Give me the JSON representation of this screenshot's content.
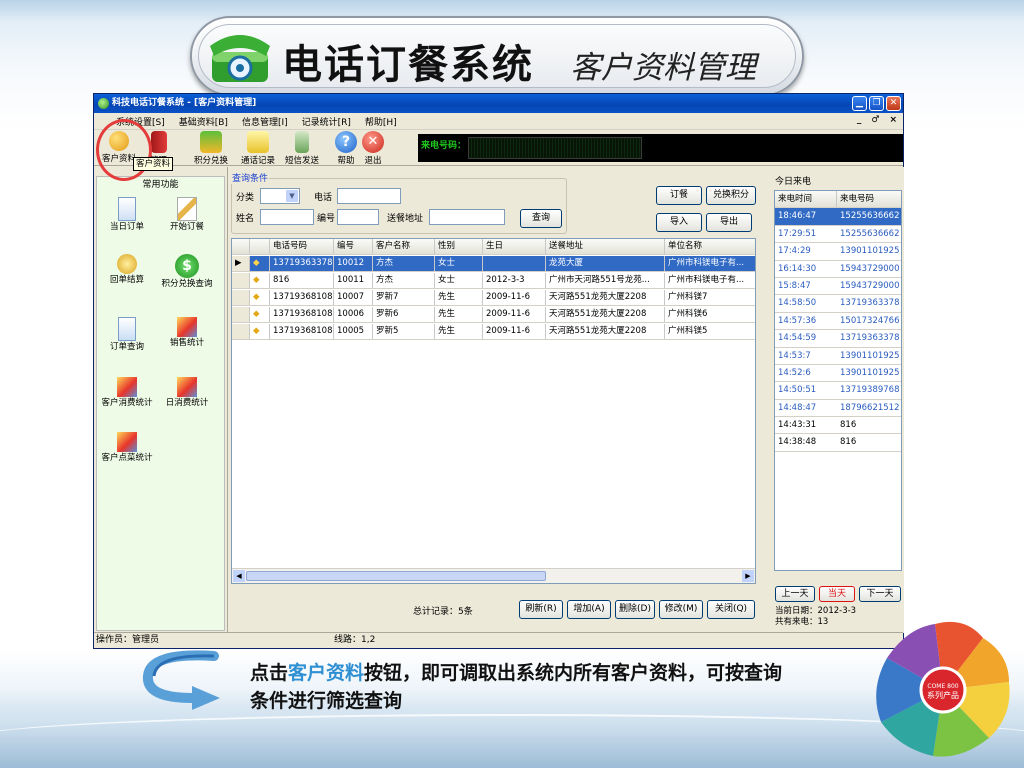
{
  "slide": {
    "title": "电话订餐系统",
    "subtitle": "客户资料管理",
    "caption_prefix": "点击",
    "caption_highlight": "客户资料",
    "caption_rest": "按钮，即可调取出系统内所有客户资料，可按查询条件进行筛选查询",
    "highlight_color": "#2e8fd2",
    "circle_color": "#e43b3b"
  },
  "window": {
    "title": "科技电话订餐系统 - [客户资料管理]",
    "buttons": [
      "minimize-icon",
      "restore-icon",
      "close-icon"
    ],
    "menus": [
      "系统设置[S]",
      "基础资料[B]",
      "信息管理[I]",
      "记录统计[R]",
      "帮助[H]"
    ],
    "mdi_controls": [
      "_",
      "♂",
      "×"
    ]
  },
  "toolbar": {
    "items": [
      "客户资料",
      "代",
      "积分兑换",
      "通话记录",
      "短信发送",
      "帮助",
      "退出"
    ],
    "manage_label": "管理",
    "tooltip": "客户资料",
    "caller_label": "来电号码："
  },
  "left": {
    "heading": "常用功能",
    "items": [
      "当日订单",
      "开始订餐",
      "回单结算",
      "积分兑换查询",
      "订单查询",
      "销售统计",
      "客户消费统计",
      "日消费统计",
      "客户点菜统计"
    ]
  },
  "query": {
    "legend": "查询条件",
    "category_label": "分类",
    "phone_label": "电话",
    "name_label": "姓名",
    "number_label": "编号",
    "address_label": "送餐地址",
    "search_button": "查询",
    "order_button": "订餐",
    "redeem_button": "兑换积分",
    "import_button": "导入",
    "export_button": "导出"
  },
  "table": {
    "columns": [
      "电话号码",
      "编号",
      "客户名称",
      "性别",
      "生日",
      "送餐地址",
      "单位名称"
    ],
    "rows": [
      [
        "13719363378",
        "10012",
        "方杰",
        "女士",
        "",
        "龙苑大厦",
        "广州市科镁电子有..."
      ],
      [
        "816",
        "10011",
        "方杰",
        "女士",
        "2012-3-3",
        "广州市天河路551号龙苑...",
        "广州市科镁电子有..."
      ],
      [
        "13719368108",
        "10007",
        "罗新7",
        "先生",
        "2009-11-6",
        "天河路551龙苑大厦2208",
        "广州科镁7"
      ],
      [
        "13719368108",
        "10006",
        "罗新6",
        "先生",
        "2009-11-6",
        "天河路551龙苑大厦2208",
        "广州科镁6"
      ],
      [
        "13719368108",
        "10005",
        "罗新5",
        "先生",
        "2009-11-6",
        "天河路551龙苑大厦2208",
        "广州科镁5"
      ]
    ],
    "selected_row": 0,
    "total": "总计记录：5条",
    "refresh_button": "刷新(R)",
    "add_button": "增加(A)",
    "delete_button": "删除(D)",
    "edit_button": "修改(M)",
    "close_button": "关闭(Q)"
  },
  "incoming": {
    "heading": "今日来电",
    "col_time": "来电时间",
    "col_number": "来电号码",
    "rows": [
      [
        "18:46:47",
        "15255636662"
      ],
      [
        "17:29:51",
        "15255636662"
      ],
      [
        "17:4:29",
        "13901101925"
      ],
      [
        "16:14:30",
        "15943729000"
      ],
      [
        "15:8:47",
        "15943729000"
      ],
      [
        "14:58:50",
        "13719363378"
      ],
      [
        "14:57:36",
        "15017324766"
      ],
      [
        "14:54:59",
        "13719363378"
      ],
      [
        "14:53:7",
        "13901101925"
      ],
      [
        "14:52:6",
        "13901101925"
      ],
      [
        "14:50:51",
        "13719389768"
      ],
      [
        "14:48:47",
        "18796621512"
      ],
      [
        "14:43:31",
        "816"
      ],
      [
        "14:38:48",
        "816"
      ]
    ],
    "prev_day": "上一天",
    "today": "当天",
    "next_day": "下一天",
    "current_date": "当前日期：2012-3-3",
    "total_calls": "共有来电：13"
  },
  "status": {
    "operator": "操作员：管理员",
    "line": "线路：1,2"
  },
  "product_badge": {
    "line1": "COME 800",
    "line2": "系列产品"
  }
}
